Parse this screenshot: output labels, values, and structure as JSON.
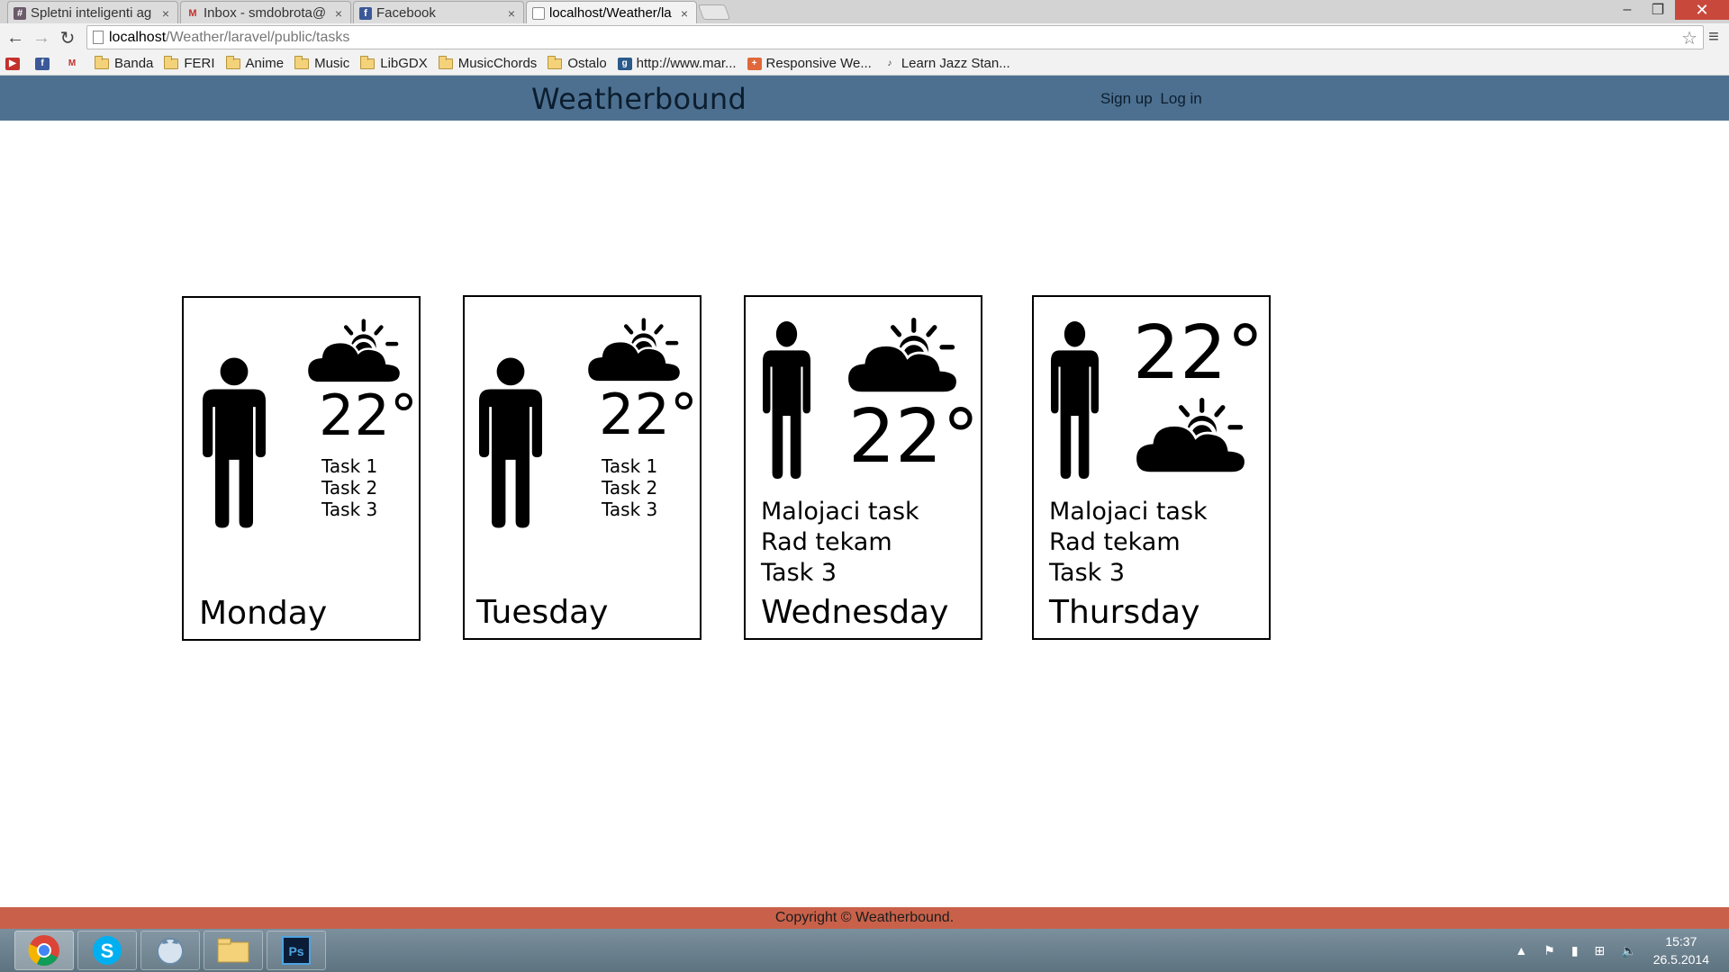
{
  "browser": {
    "tabs": [
      {
        "title": "Spletni inteligenti ag",
        "favicon": "hash-icon",
        "active": false
      },
      {
        "title": "Inbox - smdobrota@",
        "favicon": "gmail-icon",
        "active": false
      },
      {
        "title": "Facebook",
        "favicon": "facebook-icon",
        "active": false
      },
      {
        "title": "localhost/Weather/la",
        "favicon": "page-icon",
        "active": true
      }
    ],
    "address": {
      "host": "localhost",
      "path": "/Weather/laravel/public/tasks"
    },
    "bookmarks": [
      "Banda",
      "FERI",
      "Anime",
      "Music",
      "LibGDX",
      "MusicChords",
      "Ostalo",
      "http://www.mar...",
      "Responsive We...",
      "Learn Jazz Stan..."
    ]
  },
  "site": {
    "brand": "Weatherbound",
    "signup": "Sign up",
    "login": "Log in",
    "footer": "Copyright © Weatherbound."
  },
  "cards": [
    {
      "day": "Monday",
      "temp": "22°",
      "tasks": [
        "Task 1",
        "Task 2",
        "Task 3"
      ]
    },
    {
      "day": "Tuesday",
      "temp": "22°",
      "tasks": [
        "Task 1",
        "Task 2",
        "Task 3"
      ]
    },
    {
      "day": "Wednesday",
      "temp": "22°",
      "tasks": [
        "Malojaci task",
        "Rad tekam",
        "Task 3"
      ]
    },
    {
      "day": "Thursday",
      "temp": "22°",
      "tasks": [
        "Malojaci task",
        "Rad tekam",
        "Task 3"
      ]
    }
  ],
  "taskbar": {
    "apps": [
      "chrome-icon",
      "skype-icon",
      "messenger-icon",
      "file-explorer-icon",
      "photoshop-icon"
    ],
    "time": "15:37",
    "date": "26.5.2014"
  },
  "colors": {
    "header": "#4d7090",
    "footer": "#c9614a"
  }
}
